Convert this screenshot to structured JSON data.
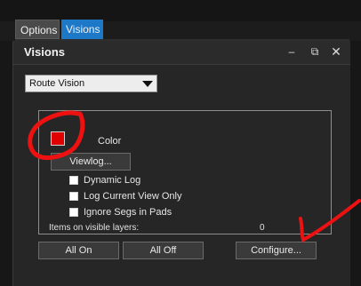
{
  "tabs": [
    {
      "label": "Options"
    },
    {
      "label": "Visions"
    }
  ],
  "panel": {
    "title": "Visions",
    "header_controls": {
      "minimize": "–",
      "restore": "⧉",
      "close": "✕"
    }
  },
  "vision_select": {
    "value": "Route Vision"
  },
  "color_group": {
    "color_label": "Color",
    "swatch_color": "#e00000",
    "viewlog_button": "Viewlog...",
    "options": [
      {
        "label": "Dynamic Log",
        "checked": false
      },
      {
        "label": "Log Current View Only",
        "checked": false
      },
      {
        "label": "Ignore Segs in Pads",
        "checked": false
      }
    ],
    "items_label": "Items on visible layers:",
    "items_count": "0"
  },
  "buttons": {
    "all_on": "All On",
    "all_off": "All Off",
    "configure": "Configure..."
  },
  "colors": {
    "accent_tab": "#1d78c8",
    "annotation": "#ee1111"
  },
  "icons": {
    "minimize": "minimize-icon",
    "restore": "restore-icon",
    "close": "close-icon",
    "dropdown": "chevron-down-icon"
  }
}
